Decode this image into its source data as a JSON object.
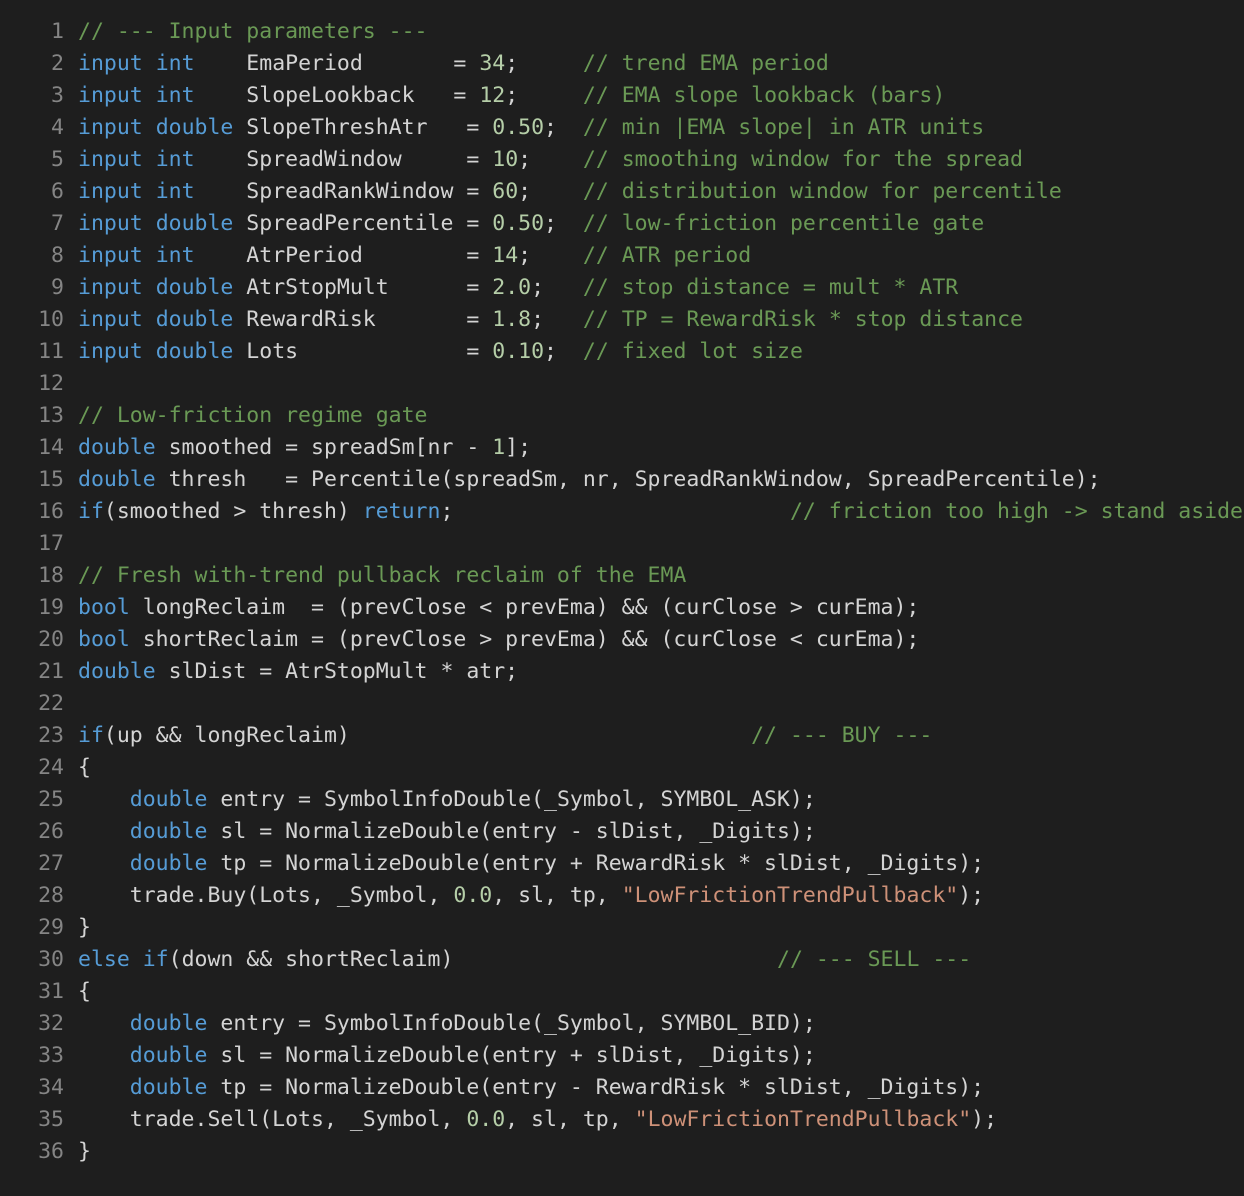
{
  "editor": {
    "colors": {
      "background": "#1e1e1e",
      "line_number": "#858585",
      "text": "#d4d4d4",
      "keyword": "#569cd6",
      "number": "#b5cea8",
      "string": "#ce9178",
      "comment": "#6a9955"
    },
    "lines": [
      {
        "n": "1",
        "tokens": [
          [
            "cmt",
            "// --- Input parameters ---"
          ]
        ]
      },
      {
        "n": "2",
        "tokens": [
          [
            "kw",
            "input"
          ],
          [
            "txt",
            " "
          ],
          [
            "kw",
            "int"
          ],
          [
            "txt",
            "    EmaPeriod       = "
          ],
          [
            "num",
            "34"
          ],
          [
            "txt",
            ";     "
          ],
          [
            "cmt",
            "// trend EMA period"
          ]
        ]
      },
      {
        "n": "3",
        "tokens": [
          [
            "kw",
            "input"
          ],
          [
            "txt",
            " "
          ],
          [
            "kw",
            "int"
          ],
          [
            "txt",
            "    SlopeLookback   = "
          ],
          [
            "num",
            "12"
          ],
          [
            "txt",
            ";     "
          ],
          [
            "cmt",
            "// EMA slope lookback (bars)"
          ]
        ]
      },
      {
        "n": "4",
        "tokens": [
          [
            "kw",
            "input"
          ],
          [
            "txt",
            " "
          ],
          [
            "kw",
            "double"
          ],
          [
            "txt",
            " SlopeThreshAtr   = "
          ],
          [
            "num",
            "0.50"
          ],
          [
            "txt",
            ";  "
          ],
          [
            "cmt",
            "// min |EMA slope| in ATR units"
          ]
        ]
      },
      {
        "n": "5",
        "tokens": [
          [
            "kw",
            "input"
          ],
          [
            "txt",
            " "
          ],
          [
            "kw",
            "int"
          ],
          [
            "txt",
            "    SpreadWindow     = "
          ],
          [
            "num",
            "10"
          ],
          [
            "txt",
            ";    "
          ],
          [
            "cmt",
            "// smoothing window for the spread"
          ]
        ]
      },
      {
        "n": "6",
        "tokens": [
          [
            "kw",
            "input"
          ],
          [
            "txt",
            " "
          ],
          [
            "kw",
            "int"
          ],
          [
            "txt",
            "    SpreadRankWindow = "
          ],
          [
            "num",
            "60"
          ],
          [
            "txt",
            ";    "
          ],
          [
            "cmt",
            "// distribution window for percentile"
          ]
        ]
      },
      {
        "n": "7",
        "tokens": [
          [
            "kw",
            "input"
          ],
          [
            "txt",
            " "
          ],
          [
            "kw",
            "double"
          ],
          [
            "txt",
            " SpreadPercentile = "
          ],
          [
            "num",
            "0.50"
          ],
          [
            "txt",
            ";  "
          ],
          [
            "cmt",
            "// low-friction percentile gate"
          ]
        ]
      },
      {
        "n": "8",
        "tokens": [
          [
            "kw",
            "input"
          ],
          [
            "txt",
            " "
          ],
          [
            "kw",
            "int"
          ],
          [
            "txt",
            "    AtrPeriod        = "
          ],
          [
            "num",
            "14"
          ],
          [
            "txt",
            ";    "
          ],
          [
            "cmt",
            "// ATR period"
          ]
        ]
      },
      {
        "n": "9",
        "tokens": [
          [
            "kw",
            "input"
          ],
          [
            "txt",
            " "
          ],
          [
            "kw",
            "double"
          ],
          [
            "txt",
            " AtrStopMult      = "
          ],
          [
            "num",
            "2.0"
          ],
          [
            "txt",
            ";   "
          ],
          [
            "cmt",
            "// stop distance = mult * ATR"
          ]
        ]
      },
      {
        "n": "10",
        "tokens": [
          [
            "kw",
            "input"
          ],
          [
            "txt",
            " "
          ],
          [
            "kw",
            "double"
          ],
          [
            "txt",
            " RewardRisk       = "
          ],
          [
            "num",
            "1.8"
          ],
          [
            "txt",
            ";   "
          ],
          [
            "cmt",
            "// TP = RewardRisk * stop distance"
          ]
        ]
      },
      {
        "n": "11",
        "tokens": [
          [
            "kw",
            "input"
          ],
          [
            "txt",
            " "
          ],
          [
            "kw",
            "double"
          ],
          [
            "txt",
            " Lots             = "
          ],
          [
            "num",
            "0.10"
          ],
          [
            "txt",
            ";  "
          ],
          [
            "cmt",
            "// fixed lot size"
          ]
        ]
      },
      {
        "n": "12",
        "tokens": []
      },
      {
        "n": "13",
        "tokens": [
          [
            "cmt",
            "// Low-friction regime gate"
          ]
        ]
      },
      {
        "n": "14",
        "tokens": [
          [
            "kw",
            "double"
          ],
          [
            "txt",
            " smoothed = spreadSm[nr - "
          ],
          [
            "num",
            "1"
          ],
          [
            "txt",
            "];"
          ]
        ]
      },
      {
        "n": "15",
        "tokens": [
          [
            "kw",
            "double"
          ],
          [
            "txt",
            " thresh   = Percentile(spreadSm, nr, SpreadRankWindow, SpreadPercentile);"
          ]
        ]
      },
      {
        "n": "16",
        "tokens": [
          [
            "kw",
            "if"
          ],
          [
            "txt",
            "(smoothed > thresh) "
          ],
          [
            "kw",
            "return"
          ],
          [
            "txt",
            ";                          "
          ],
          [
            "cmt",
            "// friction too high -> stand aside"
          ]
        ]
      },
      {
        "n": "17",
        "tokens": []
      },
      {
        "n": "18",
        "tokens": [
          [
            "cmt",
            "// Fresh with-trend pullback reclaim of the EMA"
          ]
        ]
      },
      {
        "n": "19",
        "tokens": [
          [
            "kw",
            "bool"
          ],
          [
            "txt",
            " longReclaim  = (prevClose < prevEma) && (curClose > curEma);"
          ]
        ]
      },
      {
        "n": "20",
        "tokens": [
          [
            "kw",
            "bool"
          ],
          [
            "txt",
            " shortReclaim = (prevClose > prevEma) && (curClose < curEma);"
          ]
        ]
      },
      {
        "n": "21",
        "tokens": [
          [
            "kw",
            "double"
          ],
          [
            "txt",
            " slDist = AtrStopMult * atr;"
          ]
        ]
      },
      {
        "n": "22",
        "tokens": []
      },
      {
        "n": "23",
        "tokens": [
          [
            "kw",
            "if"
          ],
          [
            "txt",
            "(up && longReclaim)                               "
          ],
          [
            "cmt",
            "// --- BUY ---"
          ]
        ]
      },
      {
        "n": "24",
        "tokens": [
          [
            "txt",
            "{"
          ]
        ]
      },
      {
        "n": "25",
        "tokens": [
          [
            "txt",
            "    "
          ],
          [
            "kw",
            "double"
          ],
          [
            "txt",
            " entry = SymbolInfoDouble(_Symbol, SYMBOL_ASK);"
          ]
        ]
      },
      {
        "n": "26",
        "tokens": [
          [
            "txt",
            "    "
          ],
          [
            "kw",
            "double"
          ],
          [
            "txt",
            " sl = NormalizeDouble(entry - slDist, _Digits);"
          ]
        ]
      },
      {
        "n": "27",
        "tokens": [
          [
            "txt",
            "    "
          ],
          [
            "kw",
            "double"
          ],
          [
            "txt",
            " tp = NormalizeDouble(entry + RewardRisk * slDist, _Digits);"
          ]
        ]
      },
      {
        "n": "28",
        "tokens": [
          [
            "txt",
            "    trade.Buy(Lots, _Symbol, "
          ],
          [
            "num",
            "0.0"
          ],
          [
            "txt",
            ", sl, tp, "
          ],
          [
            "str",
            "\"LowFrictionTrendPullback\""
          ],
          [
            "txt",
            ");"
          ]
        ]
      },
      {
        "n": "29",
        "tokens": [
          [
            "txt",
            "}"
          ]
        ]
      },
      {
        "n": "30",
        "tokens": [
          [
            "kw",
            "else"
          ],
          [
            "txt",
            " "
          ],
          [
            "kw",
            "if"
          ],
          [
            "txt",
            "(down && shortReclaim)                         "
          ],
          [
            "cmt",
            "// --- SELL ---"
          ]
        ]
      },
      {
        "n": "31",
        "tokens": [
          [
            "txt",
            "{"
          ]
        ]
      },
      {
        "n": "32",
        "tokens": [
          [
            "txt",
            "    "
          ],
          [
            "kw",
            "double"
          ],
          [
            "txt",
            " entry = SymbolInfoDouble(_Symbol, SYMBOL_BID);"
          ]
        ]
      },
      {
        "n": "33",
        "tokens": [
          [
            "txt",
            "    "
          ],
          [
            "kw",
            "double"
          ],
          [
            "txt",
            " sl = NormalizeDouble(entry + slDist, _Digits);"
          ]
        ]
      },
      {
        "n": "34",
        "tokens": [
          [
            "txt",
            "    "
          ],
          [
            "kw",
            "double"
          ],
          [
            "txt",
            " tp = NormalizeDouble(entry - RewardRisk * slDist, _Digits);"
          ]
        ]
      },
      {
        "n": "35",
        "tokens": [
          [
            "txt",
            "    trade.Sell(Lots, _Symbol, "
          ],
          [
            "num",
            "0.0"
          ],
          [
            "txt",
            ", sl, tp, "
          ],
          [
            "str",
            "\"LowFrictionTrendPullback\""
          ],
          [
            "txt",
            ");"
          ]
        ]
      },
      {
        "n": "36",
        "tokens": [
          [
            "txt",
            "}"
          ]
        ]
      }
    ]
  }
}
